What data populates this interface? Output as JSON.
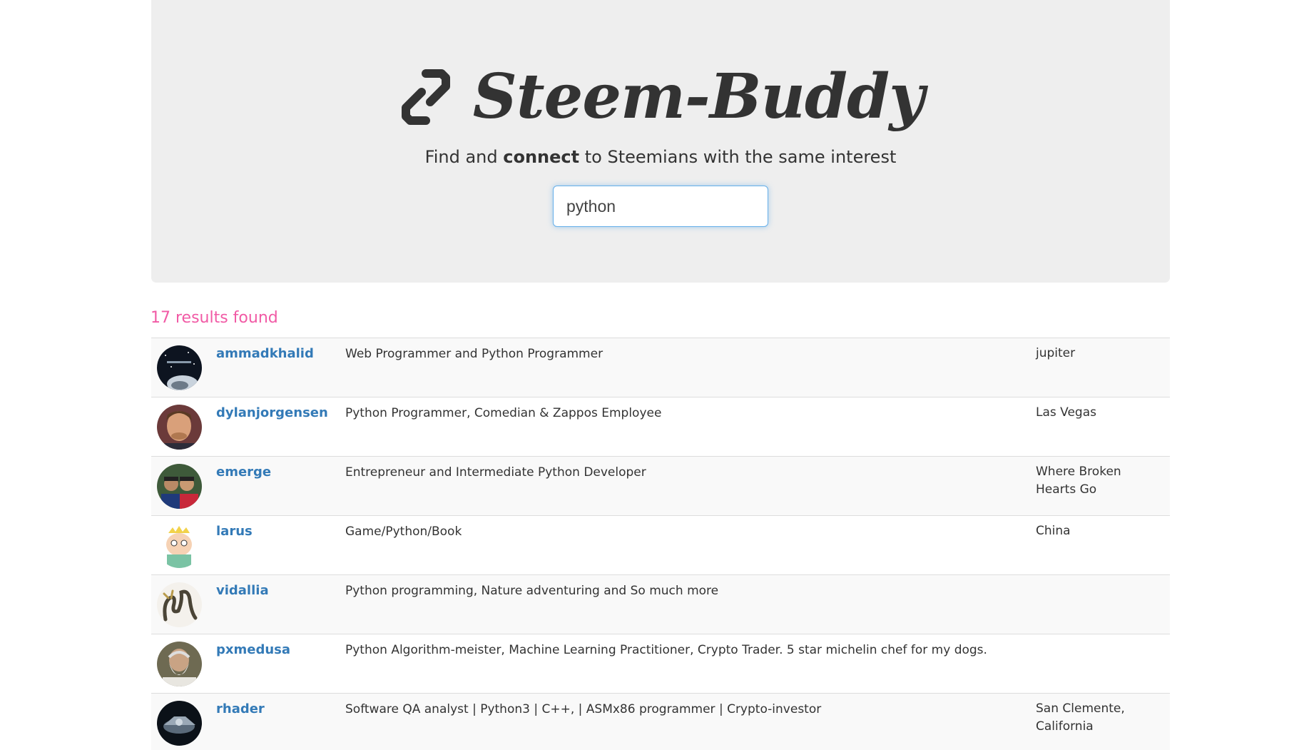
{
  "brand": {
    "title": "Steem-Buddy",
    "logo_icon": "link-chain-icon"
  },
  "tagline": {
    "prefix": "Find and ",
    "bold": "connect",
    "suffix": " to Steemians with the same interest"
  },
  "search": {
    "value": "python"
  },
  "results": {
    "count_text": "17 results found",
    "rows": [
      {
        "username": "ammadkhalid",
        "bio": "Web Programmer and Python Programmer",
        "location": "jupiter"
      },
      {
        "username": "dylanjorgensen",
        "bio": "Python Programmer, Comedian & Zappos Employee",
        "location": "Las Vegas"
      },
      {
        "username": "emerge",
        "bio": "Entrepreneur and Intermediate Python Developer",
        "location": "Where Broken Hearts Go"
      },
      {
        "username": "larus",
        "bio": "Game/Python/Book",
        "location": "China"
      },
      {
        "username": "vidallia",
        "bio": "Python programming, Nature adventuring and So much more",
        "location": ""
      },
      {
        "username": "pxmedusa",
        "bio": "Python Algorithm-meister, Machine Learning Practitioner, Crypto Trader. 5 star michelin chef for my dogs.",
        "location": ""
      },
      {
        "username": "rhader",
        "bio": "Software QA analyst | Python3 | C++, | ASMx86 programmer | Crypto-investor",
        "location": "San Clemente, California"
      }
    ]
  },
  "colors": {
    "hero_bg": "#eeeeee",
    "link": "#337ab7",
    "results_count": "#f15aa5"
  }
}
